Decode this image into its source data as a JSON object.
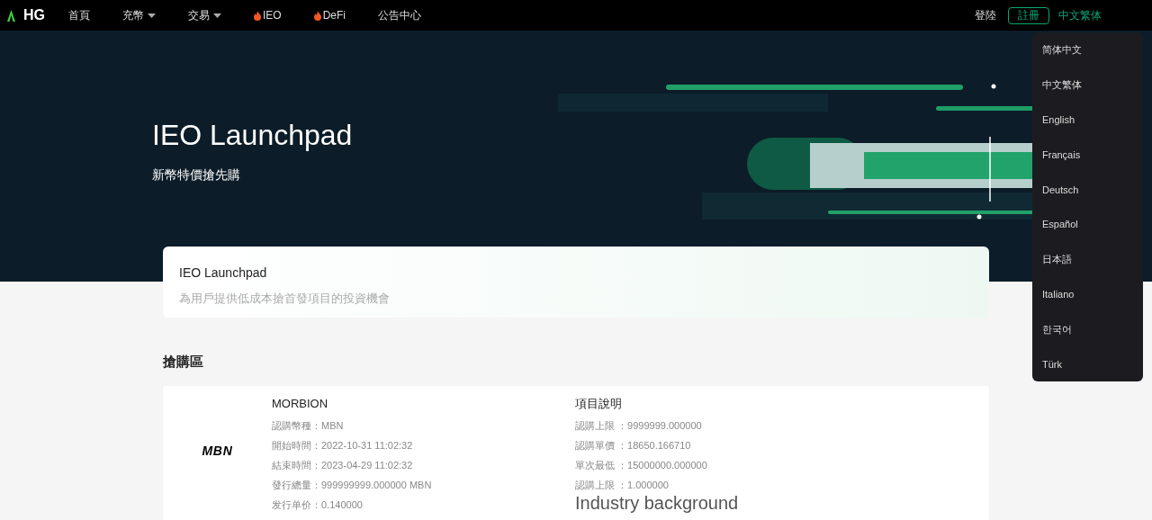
{
  "brand": "HG",
  "nav": [
    {
      "label": "首頁",
      "kind": "plain"
    },
    {
      "label": "充幣",
      "kind": "dropdown"
    },
    {
      "label": "交易",
      "kind": "dropdown"
    },
    {
      "label": "IEO",
      "kind": "flame"
    },
    {
      "label": "DeFi",
      "kind": "flame"
    },
    {
      "label": "公告中心",
      "kind": "plain"
    }
  ],
  "login": "登陸",
  "register": "註冊",
  "current_language": "中文繁体",
  "languages": [
    "简体中文",
    "中文繁体",
    "English",
    "Français",
    "Deutsch",
    "Español",
    "日本語",
    "Italiano",
    "한국어",
    "Türk"
  ],
  "hero": {
    "title": "IEO Launchpad",
    "subtitle": "新幣特價搶先購"
  },
  "intro": {
    "title": "IEO Launchpad",
    "text": "為用戶提供低成本搶首發項目的投資機會"
  },
  "section_title": "搶購區",
  "project": {
    "logo": "MBN",
    "name": "MORBION",
    "fields": [
      "認購幣種：MBN",
      "開始時間：2022-10-31 11:02:32",
      "結束時間：2023-04-29 11:02:32",
      "發行總量：999999999.000000 MBN",
      "发行单价：0.140000"
    ],
    "details_title": "項目說明",
    "details": [
      "認購上限 ：9999999.000000",
      "認購單價 ：18650.166710",
      "單次最低 ：15000000.000000",
      "認購上限 ：1.000000"
    ],
    "background_title": "Industry background"
  }
}
